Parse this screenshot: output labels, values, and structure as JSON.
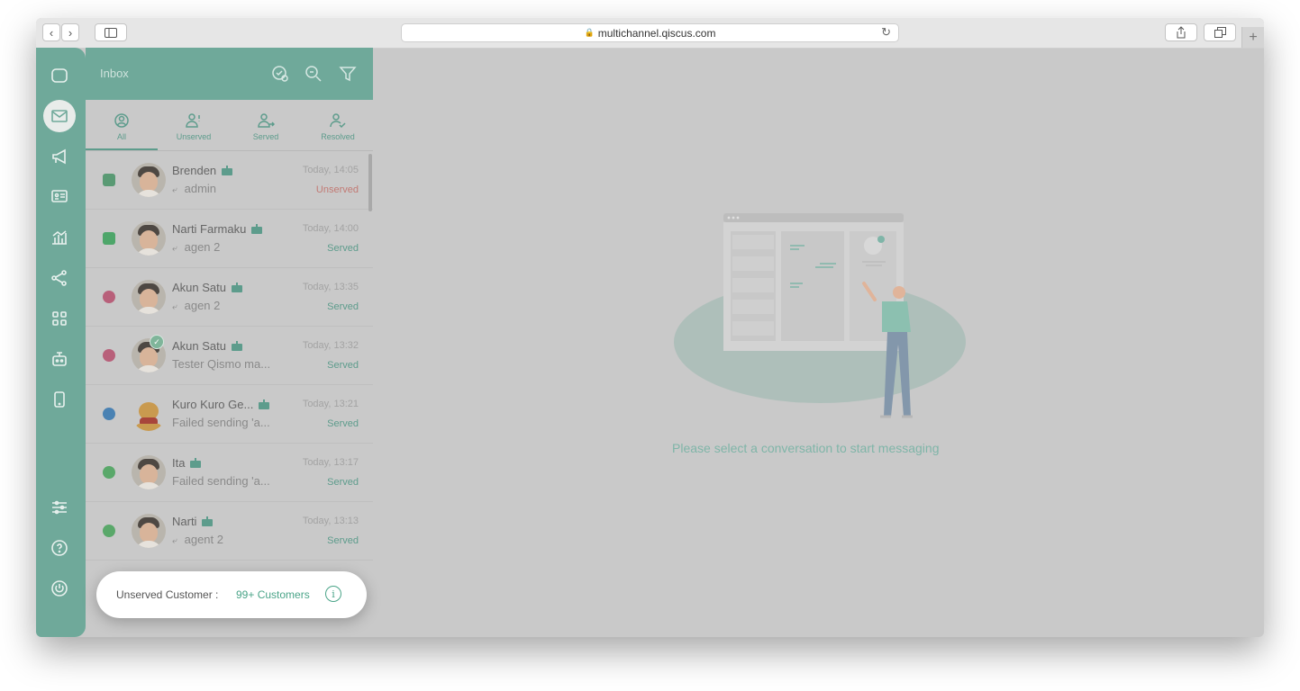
{
  "browser": {
    "url": "multichannel.qiscus.com"
  },
  "inbox": {
    "title": "Inbox",
    "tabs": [
      {
        "label": "All",
        "icon": "user-circle-icon"
      },
      {
        "label": "Unserved",
        "icon": "user-alert-icon"
      },
      {
        "label": "Served",
        "icon": "user-arrow-icon"
      },
      {
        "label": "Resolved",
        "icon": "user-check-icon"
      }
    ],
    "conversations": [
      {
        "name": "Brenden",
        "preview": "admin",
        "time": "Today, 14:05",
        "status": "Unserved",
        "channel": "qiscus-widget"
      },
      {
        "name": "Narti Farmaku",
        "preview": "agen 2",
        "time": "Today, 14:00",
        "status": "Served",
        "channel": "line"
      },
      {
        "name": "Akun Satu",
        "preview": "agen 2",
        "time": "Today, 13:35",
        "status": "Served",
        "channel": "instagram"
      },
      {
        "name": "Akun Satu",
        "preview": "Tester Qismo ma...",
        "time": "Today, 13:32",
        "status": "Served",
        "channel": "instagram"
      },
      {
        "name": "Kuro Kuro Ge...",
        "preview": "Failed sending 'a...",
        "time": "Today, 13:21",
        "status": "Served",
        "channel": "messenger"
      },
      {
        "name": "Ita",
        "preview": "Failed sending 'a...",
        "time": "Today, 13:17",
        "status": "Served",
        "channel": "whatsapp"
      },
      {
        "name": "Narti",
        "preview": "agent 2",
        "time": "Today, 13:13",
        "status": "Served",
        "channel": "whatsapp"
      }
    ]
  },
  "unserved_banner": {
    "label": "Unserved Customer :",
    "count": "99+ Customers",
    "info_glyph": "i"
  },
  "empty_state": {
    "caption": "Please select a conversation to start messaging"
  },
  "colors": {
    "brand": "#6fa99a",
    "accent": "#4aa488",
    "unserved": "#c27a74"
  }
}
